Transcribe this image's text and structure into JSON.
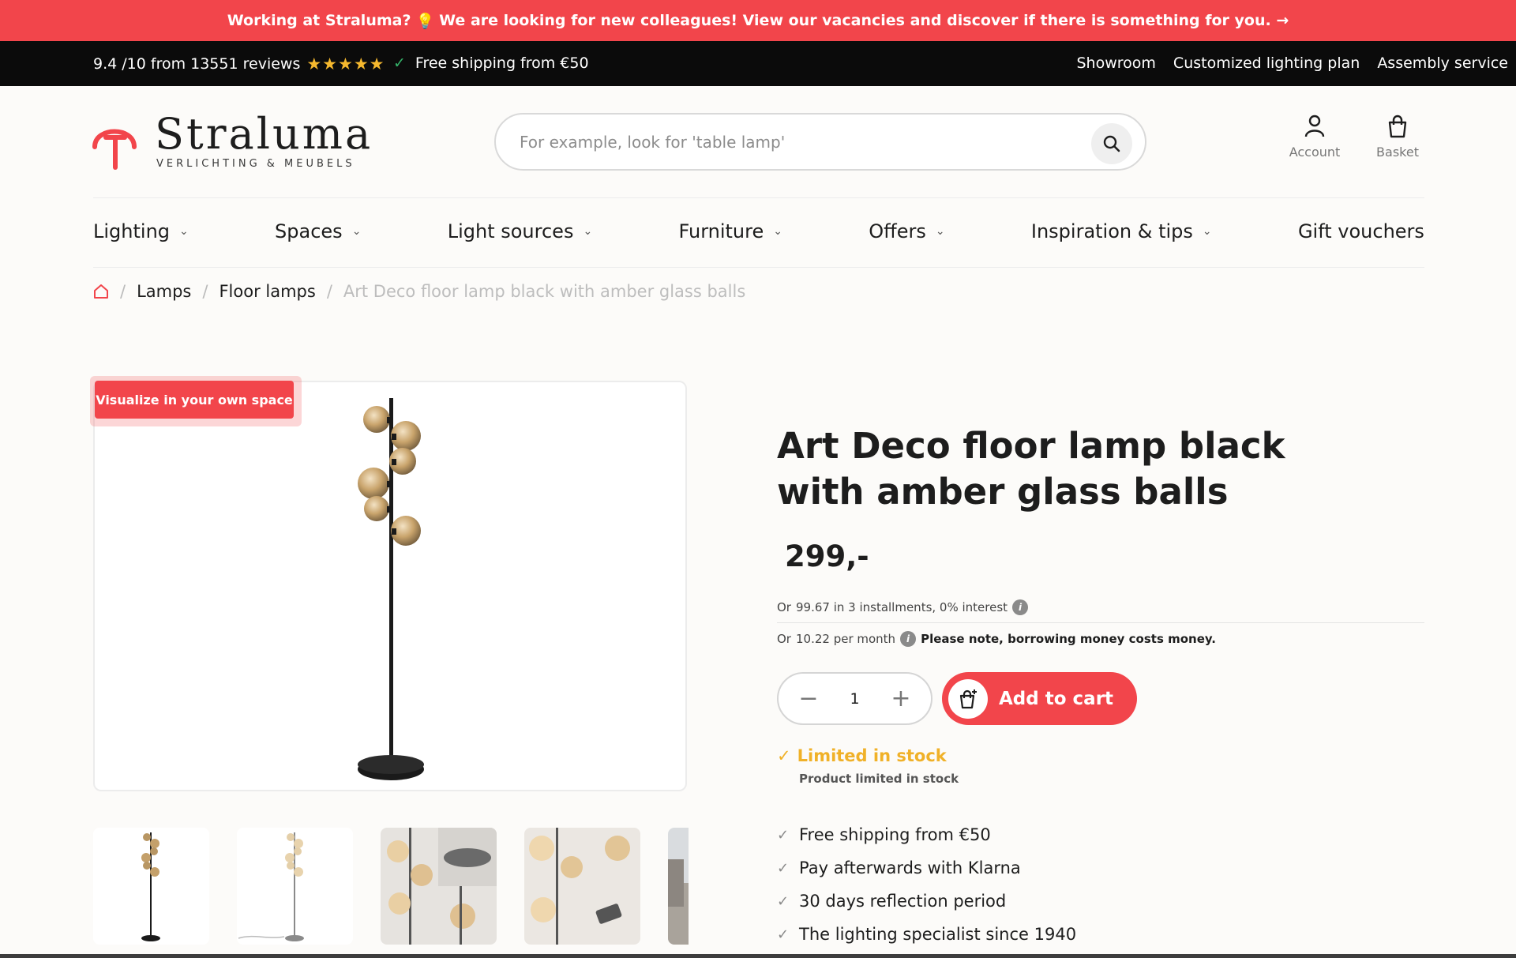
{
  "promo": {
    "text_before": "Working at Straluma?",
    "text_after": "We are looking for new colleagues! View our vacancies and discover if there is something for you. →"
  },
  "topbar": {
    "rating": "9.4 /10 from 13551 reviews",
    "stars": "★★★★★",
    "shipping": "Free shipping from €50",
    "links": [
      "Showroom",
      "Customized lighting plan",
      "Assembly service"
    ]
  },
  "header": {
    "logo_word": "Straluma",
    "logo_tagline": "VERLICHTING & MEUBELS",
    "search_placeholder": "For example, look for 'table lamp'",
    "account_label": "Account",
    "basket_label": "Basket"
  },
  "nav": [
    {
      "label": "Lighting",
      "has_dropdown": true
    },
    {
      "label": "Spaces",
      "has_dropdown": true
    },
    {
      "label": "Light sources",
      "has_dropdown": true
    },
    {
      "label": "Furniture",
      "has_dropdown": true
    },
    {
      "label": "Offers",
      "has_dropdown": true
    },
    {
      "label": "Inspiration & tips",
      "has_dropdown": true
    },
    {
      "label": "Gift vouchers",
      "has_dropdown": false
    }
  ],
  "breadcrumb": {
    "items": [
      "Lamps",
      "Floor lamps"
    ],
    "current": "Art Deco floor lamp black with amber glass balls"
  },
  "gallery": {
    "badge": "Visualize in your own space"
  },
  "product": {
    "title": "Art Deco floor lamp black with amber glass balls",
    "price": "299,-",
    "installments_or": "Or",
    "installments": "99.67 in 3 installments, 0% interest",
    "monthly_or": "Or",
    "monthly": "10.22 per month",
    "monthly_note": "Please note, borrowing money costs money.",
    "quantity": "1",
    "add_to_cart": "Add to cart",
    "stock_status": "Limited in stock",
    "stock_detail": "Product limited in stock",
    "usps": [
      "Free shipping from €50",
      "Pay afterwards with Klarna",
      "30 days reflection period",
      "The lighting specialist since 1940"
    ]
  },
  "colors": {
    "brand_red": "#f2454b",
    "stock_amber": "#f0b128",
    "star_gold": "#f5b82e"
  }
}
